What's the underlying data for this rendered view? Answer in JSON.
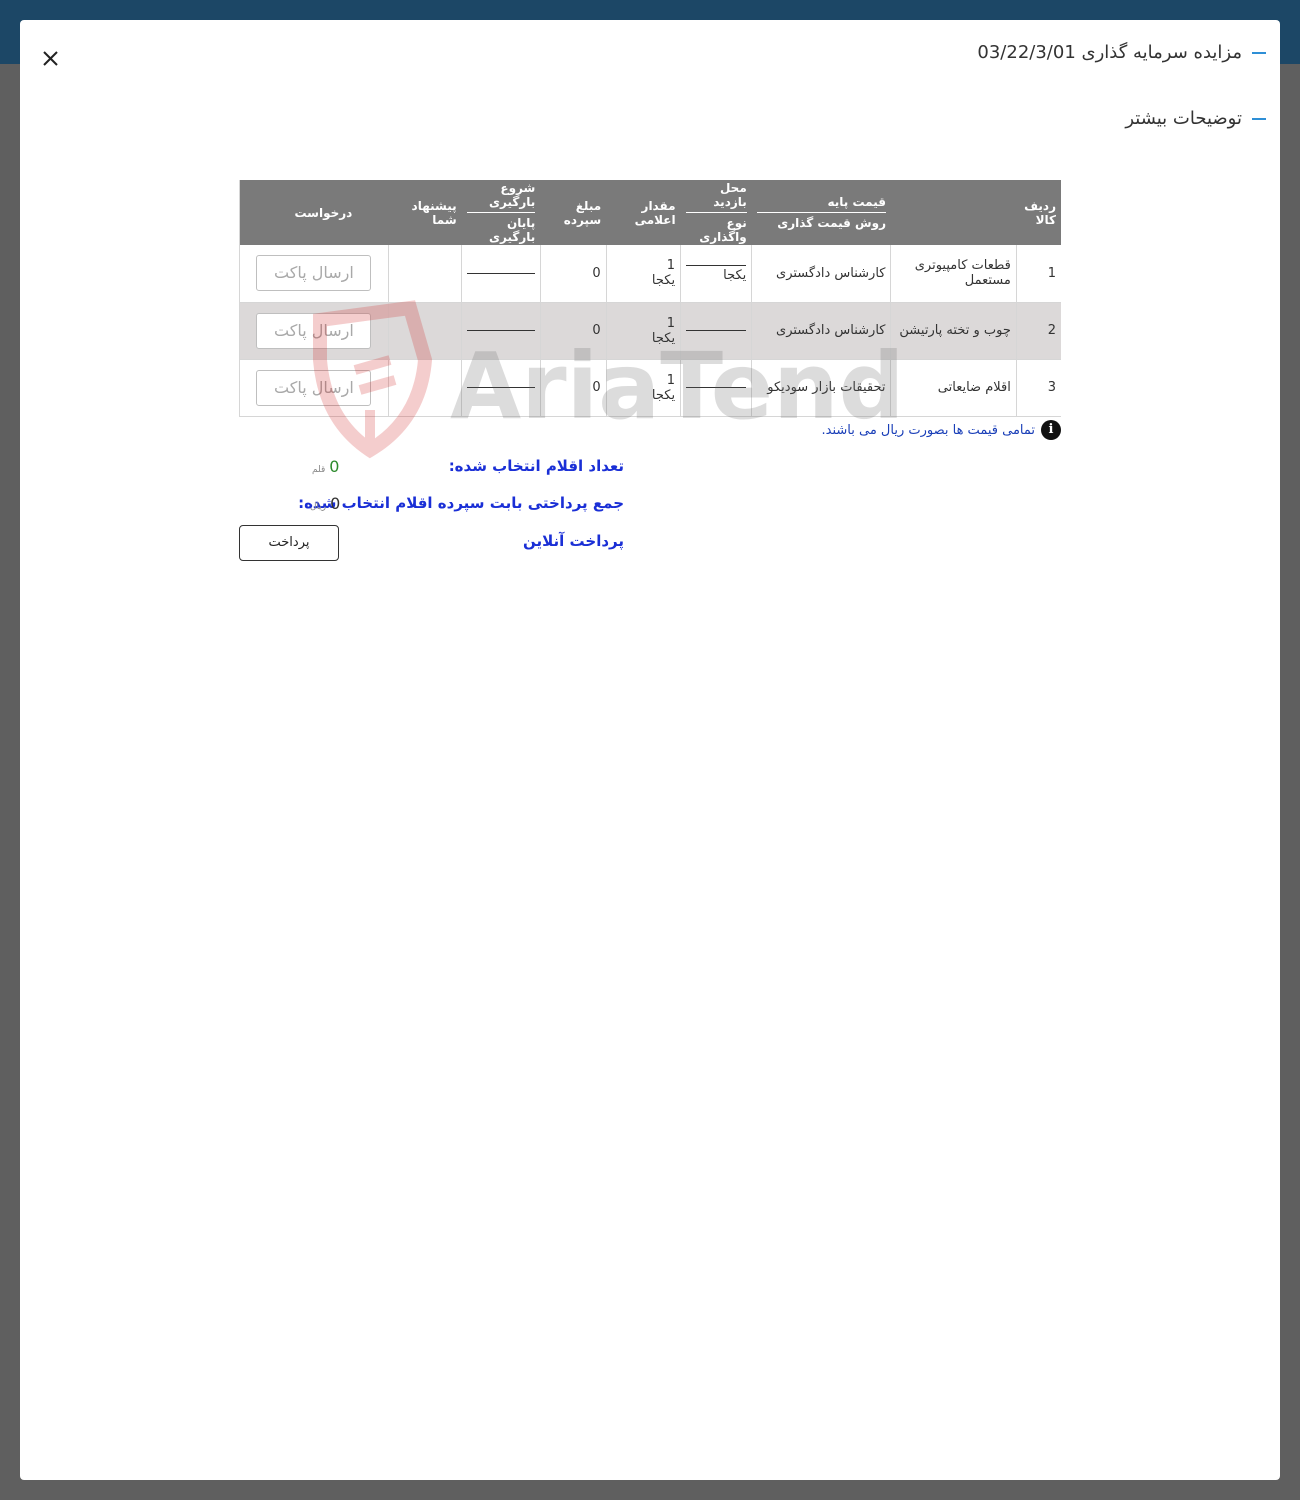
{
  "modal": {
    "title": "مزایده سرمایه گذاری 03/22/3/01",
    "more_details": "توضیحات بیشتر"
  },
  "table": {
    "headers": {
      "row_item": "ردیف کالا",
      "base_price": "قیمت پایه",
      "pricing_method": "روش قیمت گذاری",
      "visit_location": "محل بازدید",
      "transfer_type": "نوع واگذاری",
      "declared_amount": "مقدار اعلامی",
      "deposit_amount": "مبلغ سپرده",
      "loading_start": "شروع بارگیری",
      "loading_end": "پایان بارگیری",
      "your_offer": "پیشنهاد شما",
      "request": "درخواست"
    },
    "rows": [
      {
        "num": "1",
        "item": "قطعات کامپیوتری مستعمل",
        "pricing": "کارشناس دادگستری",
        "transfer": "یکجا",
        "qty": "1",
        "qty_unit": "یکجا",
        "deposit": "0",
        "action": "ارسال پاکت"
      },
      {
        "num": "2",
        "item": "چوب و تخته پارتیشن",
        "pricing": "کارشناس دادگستری",
        "transfer": "",
        "qty": "1",
        "qty_unit": "یکجا",
        "deposit": "0",
        "action": "ارسال پاکت"
      },
      {
        "num": "3",
        "item": "اقلام ضایعاتی",
        "pricing": "تحقیقات بازار سودیکو",
        "transfer": "",
        "qty": "1",
        "qty_unit": "یکجا",
        "deposit": "0",
        "action": "ارسال پاکت"
      }
    ]
  },
  "watermark": "AriaTender.neT",
  "note": "تمامی قیمت ها بصورت ریال می باشند.",
  "summary": {
    "selected_count_label": "تعداد اقلام انتخاب شده:",
    "selected_count_value": "0",
    "selected_count_unit": "قلم",
    "total_payment_label": "جمع پرداختی بابت سپرده اقلام انتخاب شده:",
    "total_payment_value": "0",
    "total_payment_unit": "ریال",
    "online_payment_label": "پرداخت آنلاین",
    "pay_button": "پرداخت"
  },
  "colors": {
    "topbar": "#1c4766",
    "accent_dash": "#2e8fd6",
    "header_bg": "#7a7a7a",
    "summary_text": "#1a2fd6"
  }
}
